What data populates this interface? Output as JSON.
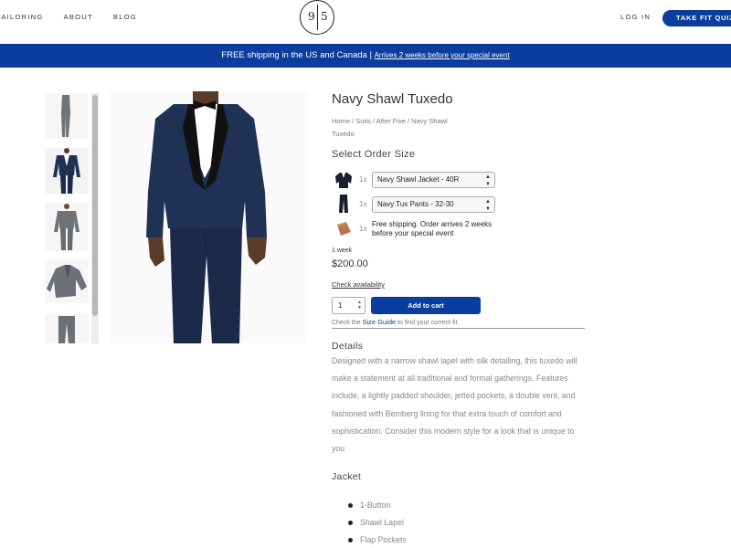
{
  "header": {
    "nav": [
      "TAILORING",
      "ABOUT",
      "BLOG"
    ],
    "logo_left": "9",
    "logo_right": "5",
    "login": "LOG IN",
    "quiz_button": "TAKE FIT QUIZ"
  },
  "banner": {
    "text": "FREE shipping in the US and Canada | ",
    "link": "Arrives 2 weeks before your special event"
  },
  "product": {
    "title": "Navy Shawl Tuxedo",
    "breadcrumb": "Home / Suits / After Five / Navy Shawl Tuxedo",
    "order_title": "Select Order Size",
    "rows": [
      {
        "qty": "1x",
        "value": "Navy Shawl Jacket - 40R",
        "icon": "jacket-icon"
      },
      {
        "qty": "1x",
        "value": "Navy Tux Pants - 32-30",
        "icon": "pants-icon"
      },
      {
        "qty": "1x",
        "value": "Free shipping. Order arrives 2 weeks before your special event",
        "icon": "box-icon"
      }
    ],
    "delivery": "1 week",
    "price": "$200.00",
    "check_availability": "Check availability",
    "quantity": "1",
    "add_to_cart": "Add to cart",
    "size_guide_pre": "Check the ",
    "size_guide_link": "Size Guide",
    "size_guide_post": " to find your correct fit."
  },
  "details": {
    "title": "Details",
    "text": "Designed with a narrow shawl lapel with silk detailing, this tuxedo will make a statement at all traditional and formal gatherings. Features include, a lightly padded shoulder, jetted pockets, a double vent, and fashioned with Bemberg lining for that extra touch of comfort and sophistication. Consider this modern style for a look that is unique to you"
  },
  "jacket": {
    "title": "Jacket",
    "features": [
      "1-Button",
      "Shawl Lapel",
      "Flap Pockets"
    ]
  },
  "colors": {
    "brand_blue": "#0b3d9e",
    "suit_navy": "#1f3155"
  }
}
